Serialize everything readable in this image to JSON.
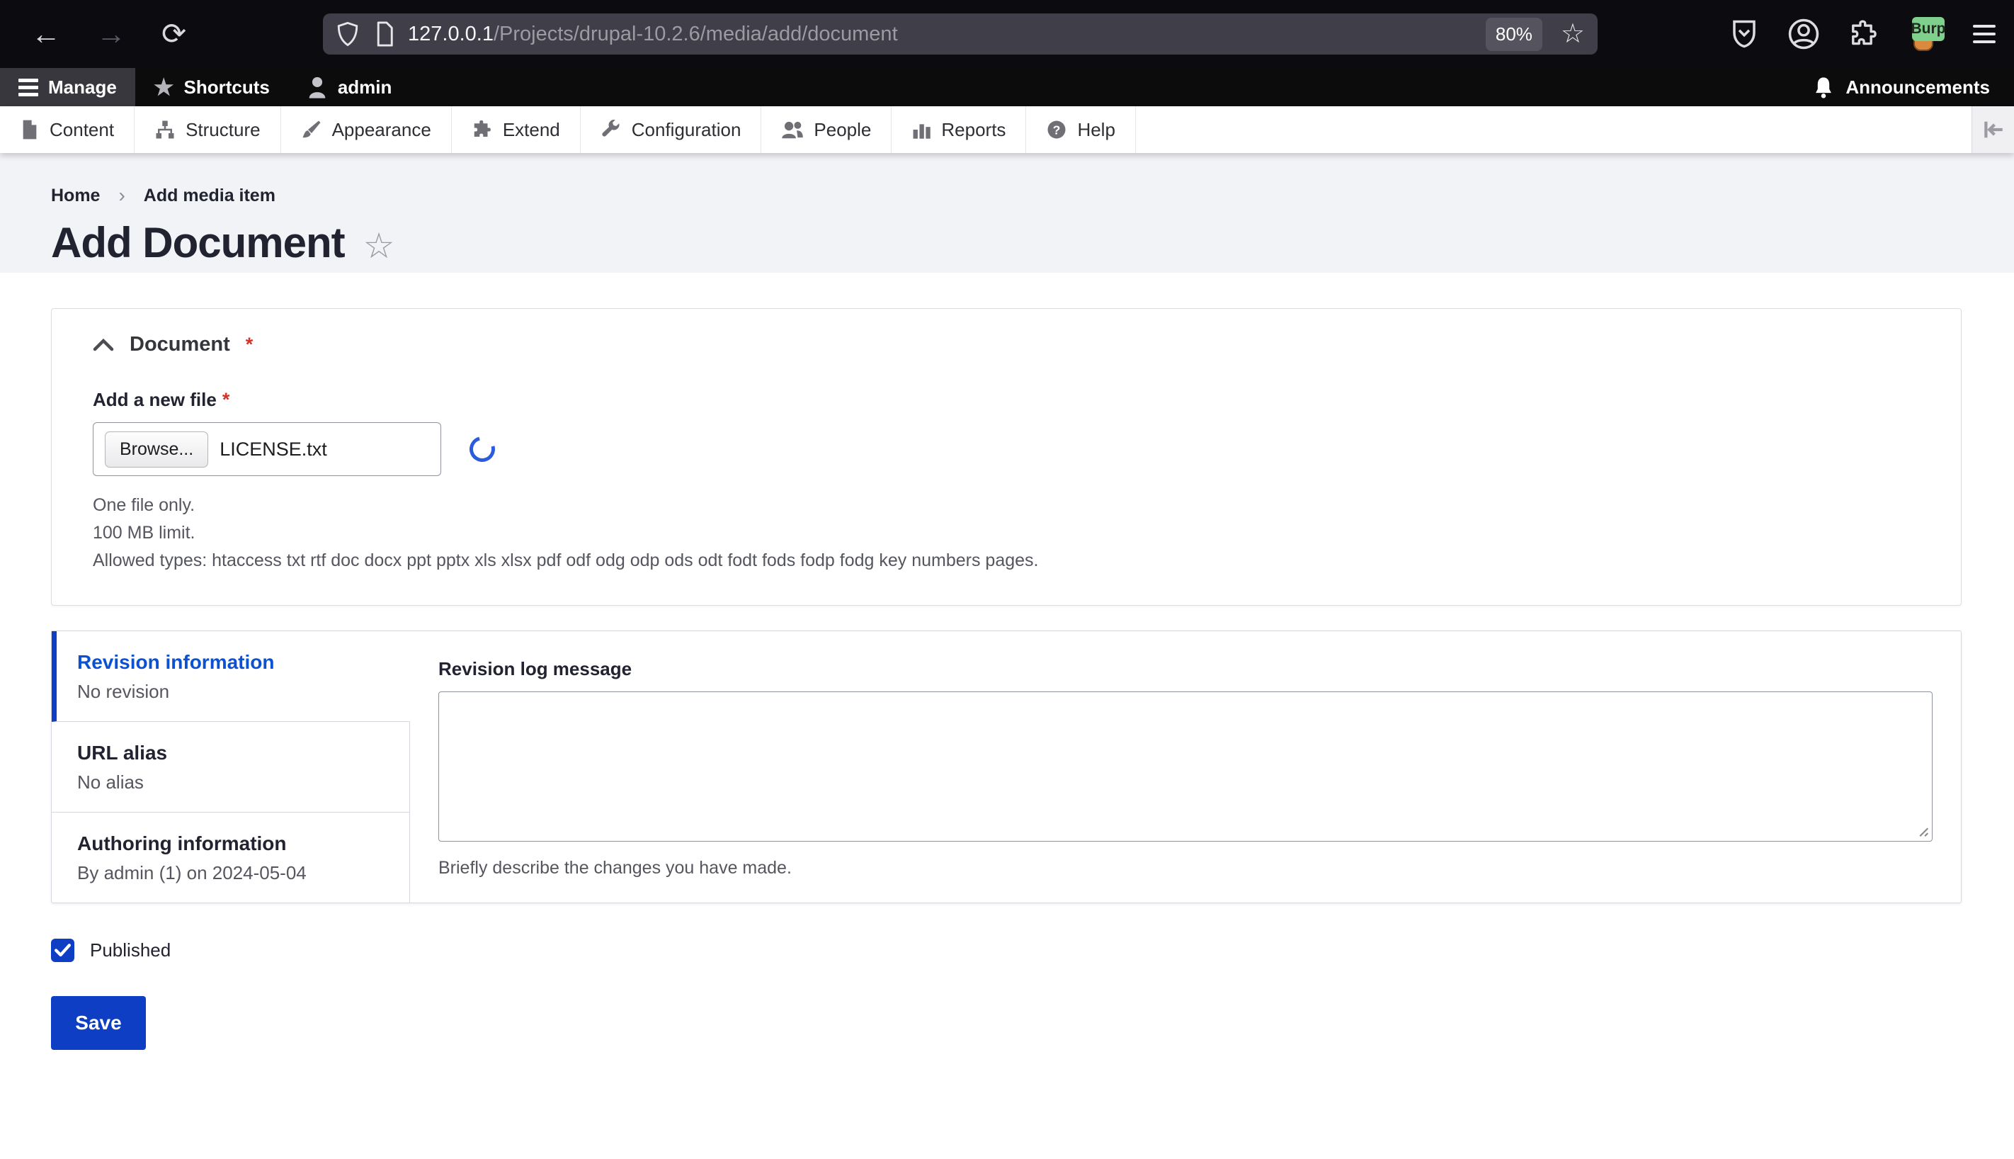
{
  "browser": {
    "url_host": "127.0.0.1",
    "url_path": "/Projects/drupal-10.2.6/media/add/document",
    "zoom_badge": "80%",
    "extension_label": "Burp"
  },
  "admin_toolbar": {
    "manage_label": "Manage",
    "shortcuts_label": "Shortcuts",
    "user_label": "admin",
    "announcements_label": "Announcements"
  },
  "menu": {
    "items": [
      {
        "label": "Content",
        "icon": "content-icon"
      },
      {
        "label": "Structure",
        "icon": "structure-icon"
      },
      {
        "label": "Appearance",
        "icon": "appearance-icon"
      },
      {
        "label": "Extend",
        "icon": "extend-icon"
      },
      {
        "label": "Configuration",
        "icon": "configuration-icon"
      },
      {
        "label": "People",
        "icon": "people-icon"
      },
      {
        "label": "Reports",
        "icon": "reports-icon"
      },
      {
        "label": "Help",
        "icon": "help-icon"
      }
    ]
  },
  "breadcrumb": {
    "home": "Home",
    "current": "Add media item"
  },
  "page": {
    "title": "Add Document"
  },
  "document_fieldset": {
    "legend": "Document",
    "required_mark": "*",
    "file_label": "Add a new file",
    "browse_button": "Browse...",
    "file_name": "LICENSE.txt",
    "help_line1": "One file only.",
    "help_line2": "100 MB limit.",
    "help_line3": "Allowed types: htaccess txt rtf doc docx ppt pptx xls xlsx pdf odf odg odp ods odt fodt fods fodp fodg key numbers pages."
  },
  "vertical_tabs": {
    "tabs": [
      {
        "title": "Revision information",
        "summary": "No revision",
        "active": true
      },
      {
        "title": "URL alias",
        "summary": "No alias",
        "active": false
      },
      {
        "title": "Authoring information",
        "summary": "By admin (1) on 2024-05-04",
        "active": false
      }
    ]
  },
  "revision_panel": {
    "label": "Revision log message",
    "textarea_value": "",
    "description": "Briefly describe the changes you have made."
  },
  "footer_form": {
    "published_label": "Published",
    "published_checked": true,
    "save_label": "Save"
  },
  "colors": {
    "accent": "#0d3ec4",
    "active_tab_text": "#0b51d2",
    "required": "#d93025",
    "toolbar_black": "#0c0c0c",
    "header_bg": "#f2f3f7"
  }
}
